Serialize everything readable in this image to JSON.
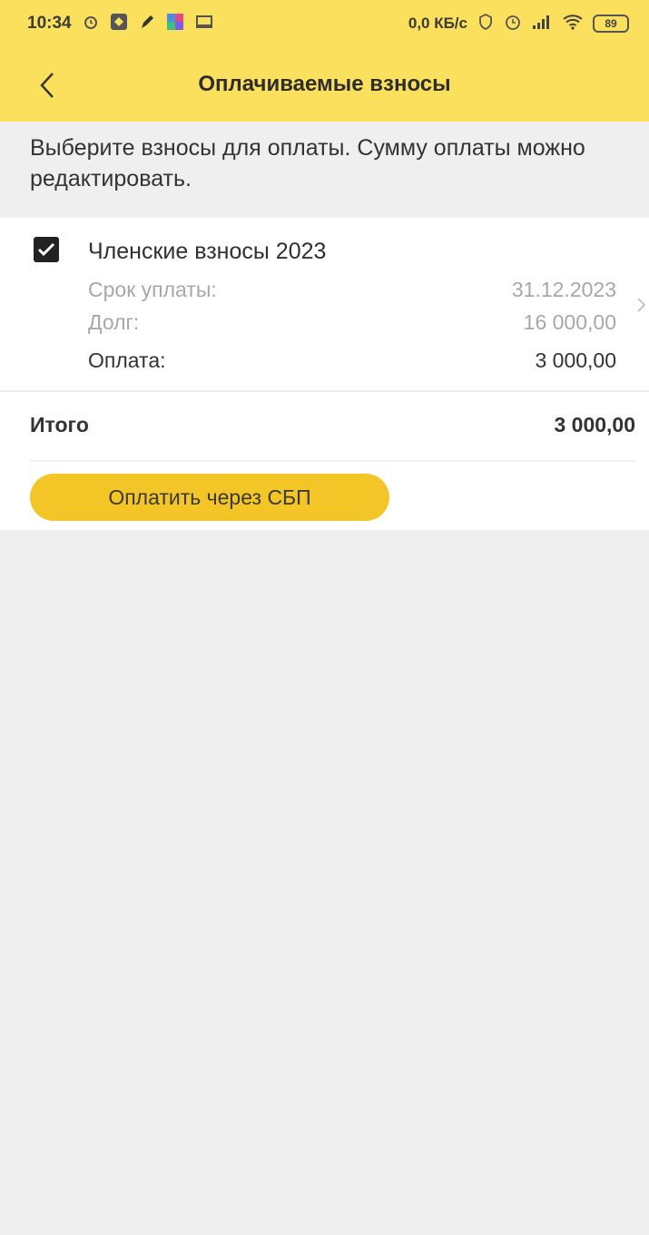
{
  "status_bar": {
    "time": "10:34",
    "speed": "0,0 КБ/с",
    "battery": "89"
  },
  "header": {
    "title": "Оплачиваемые взносы"
  },
  "hint": "Выберите взносы для оплаты. Сумму оплаты можно редактировать.",
  "fee": {
    "checked": true,
    "title": "Членские взносы 2023",
    "due_label": "Срок уплаты:",
    "due_value": "31.12.2023",
    "debt_label": "Долг:",
    "debt_value": "16 000,00",
    "payment_label": "Оплата:",
    "payment_value": "3 000,00"
  },
  "total": {
    "label": "Итого",
    "value": "3 000,00"
  },
  "pay_button": {
    "label": "Оплатить через СБП"
  },
  "colors": {
    "header_bg": "#fbe05d",
    "button_bg": "#f4c527",
    "page_bg": "#efefef"
  }
}
